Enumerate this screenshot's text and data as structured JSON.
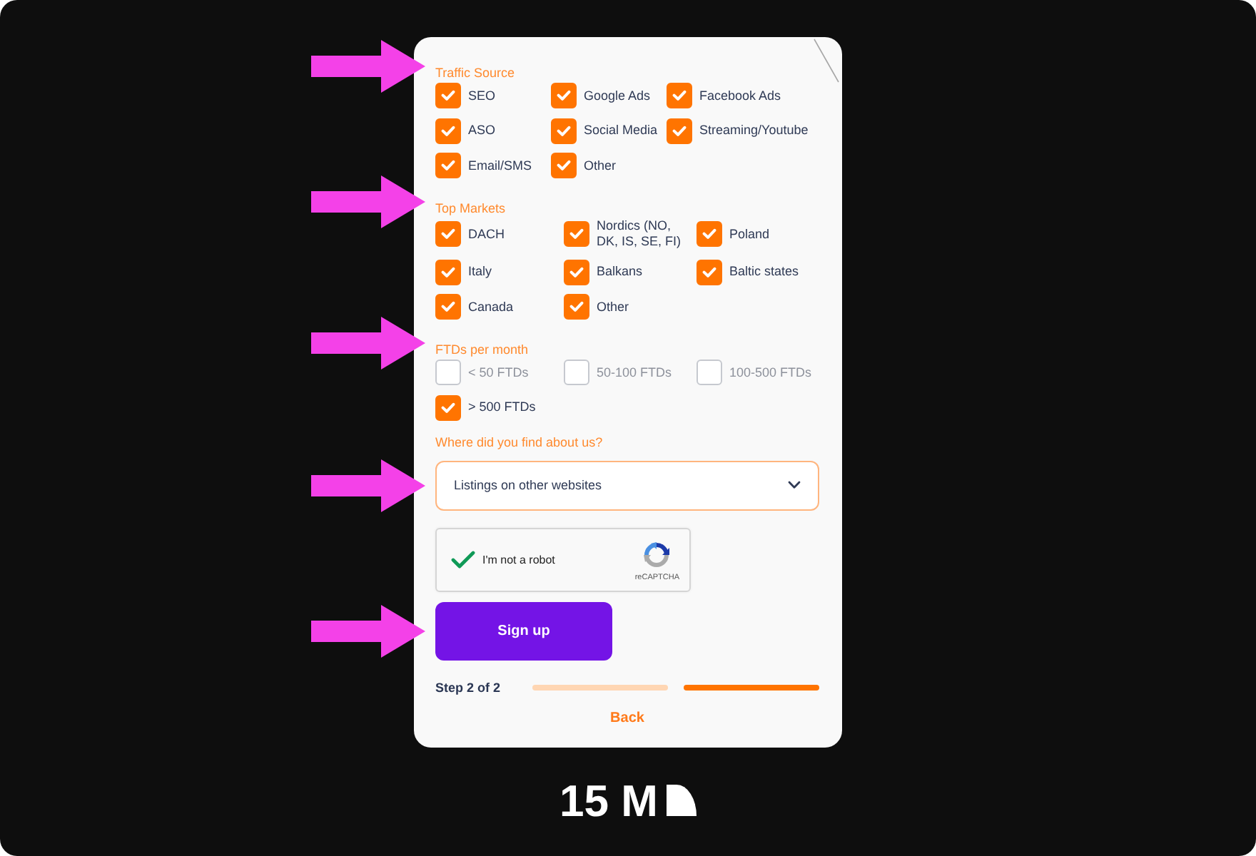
{
  "form": {
    "sections": [
      {
        "title": "Traffic Source",
        "pointed_at": true,
        "options": [
          {
            "label": "SEO",
            "checked": true
          },
          {
            "label": "Google Ads",
            "checked": true
          },
          {
            "label": "Facebook Ads",
            "checked": true
          },
          {
            "label": "ASO",
            "checked": true
          },
          {
            "label": "Social Media",
            "checked": true
          },
          {
            "label": "Streaming/Youtube",
            "checked": true
          },
          {
            "label": "Email/SMS",
            "checked": true
          },
          {
            "label": "Other",
            "checked": true
          }
        ]
      },
      {
        "title": "Top Markets",
        "pointed_at": true,
        "options": [
          {
            "label": "DACH",
            "checked": true
          },
          {
            "label": "Nordics (NO, DK, IS, SE, FI)",
            "checked": true
          },
          {
            "label": "Poland",
            "checked": true
          },
          {
            "label": "Italy",
            "checked": true
          },
          {
            "label": "Balkans",
            "checked": true
          },
          {
            "label": "Baltic states",
            "checked": true
          },
          {
            "label": "Canada",
            "checked": true
          },
          {
            "label": "Other",
            "checked": true
          }
        ]
      },
      {
        "title": "FTDs per month",
        "pointed_at": true,
        "options": [
          {
            "label": "< 50 FTDs",
            "checked": false
          },
          {
            "label": "50-100 FTDs",
            "checked": false
          },
          {
            "label": "100-500 FTDs",
            "checked": false
          },
          {
            "label": "> 500 FTDs",
            "checked": true
          }
        ]
      }
    ],
    "referral": {
      "label": "Where did you find about us?",
      "value": "Listings on other websites",
      "pointed_at": true
    },
    "captcha": {
      "label": "I'm not a robot",
      "checked": true,
      "brand": "reCAPTCHA"
    },
    "submit_button": {
      "label": "Sign up",
      "pointed_at": true
    },
    "progress": {
      "label": "Step 2 of 2",
      "segments": [
        {
          "selected": false
        },
        {
          "selected": true
        }
      ]
    },
    "back_link": "Back"
  },
  "logo": {
    "text": "15 M"
  }
}
